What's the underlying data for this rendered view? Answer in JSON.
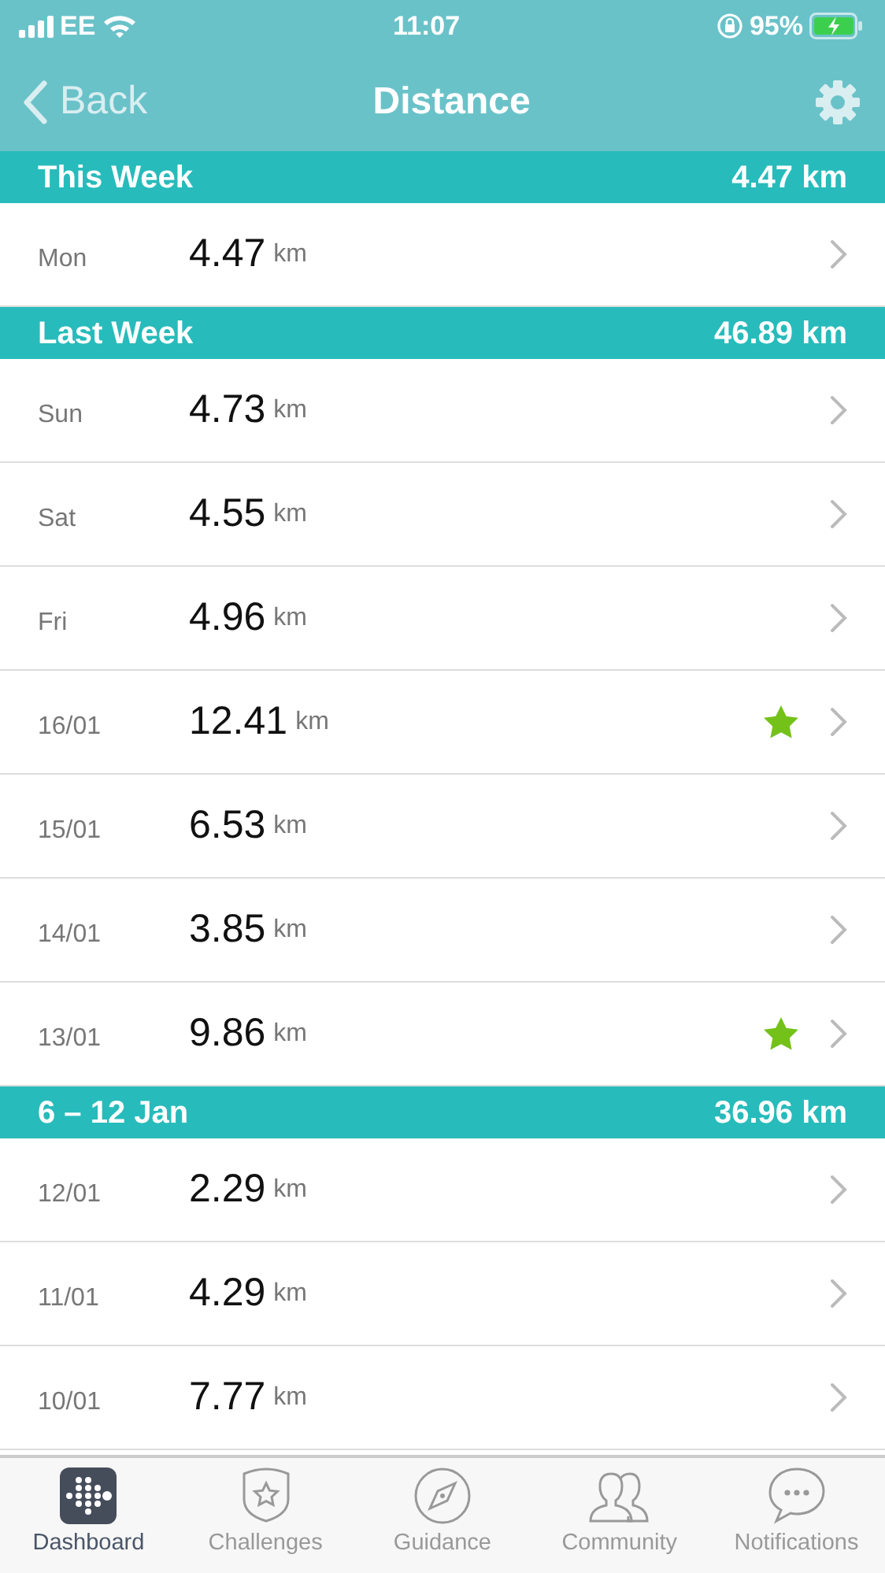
{
  "status_bar": {
    "carrier": "EE",
    "time": "11:07",
    "battery": "95%"
  },
  "nav": {
    "back": "Back",
    "title": "Distance"
  },
  "sections": [
    {
      "title": "This Week",
      "total": "4.47 km",
      "days": [
        {
          "label": "Mon",
          "value": "4.47",
          "unit": "km",
          "star": false
        }
      ]
    },
    {
      "title": "Last Week",
      "total": "46.89 km",
      "days": [
        {
          "label": "Sun",
          "value": "4.73",
          "unit": "km",
          "star": false
        },
        {
          "label": "Sat",
          "value": "4.55",
          "unit": "km",
          "star": false
        },
        {
          "label": "Fri",
          "value": "4.96",
          "unit": "km",
          "star": false
        },
        {
          "label": "16/01",
          "value": "12.41",
          "unit": "km",
          "star": true
        },
        {
          "label": "15/01",
          "value": "6.53",
          "unit": "km",
          "star": false
        },
        {
          "label": "14/01",
          "value": "3.85",
          "unit": "km",
          "star": false
        },
        {
          "label": "13/01",
          "value": "9.86",
          "unit": "km",
          "star": true
        }
      ]
    },
    {
      "title": "6 – 12 Jan",
      "total": "36.96 km",
      "days": [
        {
          "label": "12/01",
          "value": "2.29",
          "unit": "km",
          "star": false
        },
        {
          "label": "11/01",
          "value": "4.29",
          "unit": "km",
          "star": false
        },
        {
          "label": "10/01",
          "value": "7.77",
          "unit": "km",
          "star": false
        }
      ]
    }
  ],
  "tab_bar": [
    {
      "label": "Dashboard",
      "kind": "dashboard",
      "selected": true
    },
    {
      "label": "Challenges",
      "kind": "challenges",
      "selected": false
    },
    {
      "label": "Guidance",
      "kind": "guidance",
      "selected": false
    },
    {
      "label": "Community",
      "kind": "community",
      "selected": false
    },
    {
      "label": "Notifications",
      "kind": "notifications",
      "selected": false
    }
  ]
}
